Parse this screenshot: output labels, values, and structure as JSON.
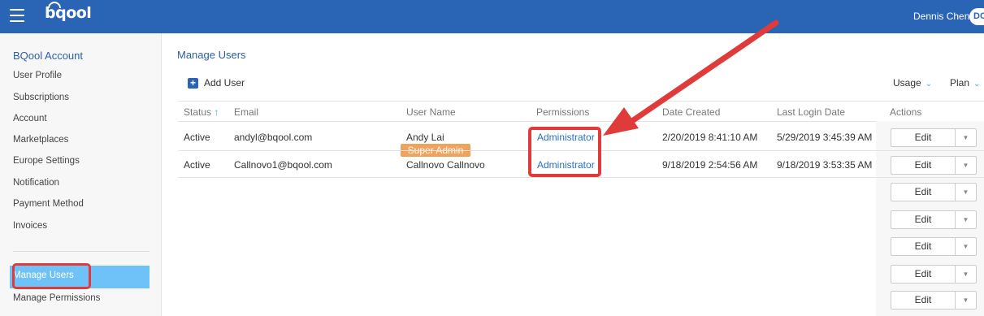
{
  "header": {
    "user_name": "Dennis Chen",
    "avatar_initials": "DC"
  },
  "brand": {
    "logo_text": "bqool"
  },
  "sidebar": {
    "title": "BQool Account",
    "items": [
      {
        "label": "User Profile"
      },
      {
        "label": "Subscriptions"
      },
      {
        "label": "Account"
      },
      {
        "label": "Marketplaces"
      },
      {
        "label": "Europe Settings"
      },
      {
        "label": "Notification"
      },
      {
        "label": "Payment Method"
      },
      {
        "label": "Invoices"
      }
    ],
    "active_label": "Manage Users",
    "next_label": "Manage Permissions"
  },
  "main": {
    "title": "Manage Users",
    "add_user_label": "Add User",
    "usage_label": "Usage",
    "plan_label": "Plan",
    "columns": {
      "status": "Status",
      "email": "Email",
      "user_name": "User Name",
      "permissions": "Permissions",
      "date_created": "Date Created",
      "last_login": "Last Login Date",
      "actions": "Actions"
    },
    "rows": [
      {
        "status": "Active",
        "email": "andyl@bqool.com",
        "user_name": "Andy Lai",
        "badge": "Super Admin",
        "permission": "Administrator",
        "date_created": "2/20/2019 8:41:10 AM",
        "last_login": "5/29/2019 3:45:39 AM"
      },
      {
        "status": "Active",
        "email": "Callnovo1@bqool.com",
        "user_name": "Callnovo Callnovo",
        "permission": "Administrator",
        "date_created": "9/18/2019 2:54:56 AM",
        "last_login": "9/18/2019 3:53:35 AM"
      }
    ],
    "edit_label": "Edit"
  },
  "colors": {
    "header_blue": "#2a64b5",
    "highlight_red": "#e03b3b",
    "active_sidebar": "#6ec2f7",
    "badge_orange": "#f0a35b"
  },
  "icons": [
    "hamburger-icon",
    "plus-icon",
    "chevron-down-icon",
    "sort-up-icon",
    "caret-down-icon"
  ]
}
